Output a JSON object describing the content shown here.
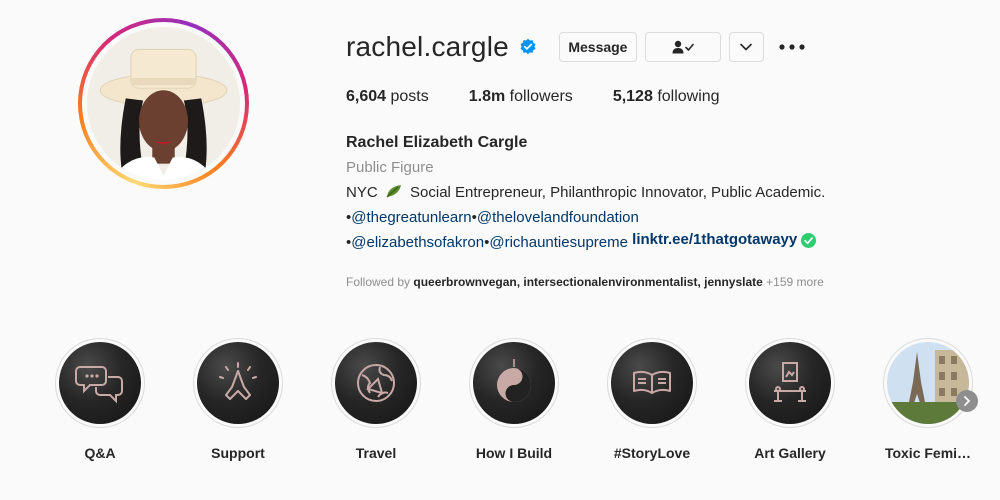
{
  "profile": {
    "username": "rachel.cargle",
    "message_label": "Message",
    "stats": {
      "posts_value": "6,604",
      "posts_label": "posts",
      "followers_value": "1.8m",
      "followers_label": "followers",
      "following_value": "5,128",
      "following_label": "following"
    },
    "bio": {
      "full_name": "Rachel Elizabeth Cargle",
      "category": "Public Figure",
      "line1_prefix": "NYC",
      "line1_text": "Social Entrepreneur, Philanthropic Innovator, Public Academic.",
      "bullet": "•",
      "mention1": "@thegreatunlearn",
      "mention2": "@thelovelandfoundation",
      "mention3": "@elizabethsofakron",
      "mention4": "@richauntiesupreme",
      "link": "linktr.ee/1thatgotawayy"
    },
    "followed_by": {
      "prefix": "Followed by",
      "names": "queerbrownvegan, intersectionalenvironmentalist, jennyslate",
      "more": "+159 more"
    }
  },
  "highlights": [
    {
      "label": "Q&A",
      "icon": "chat-bubbles-icon"
    },
    {
      "label": "Support",
      "icon": "praying-hands-icon"
    },
    {
      "label": "Travel",
      "icon": "globe-icon"
    },
    {
      "label": "How I Build",
      "icon": "yin-yang-icon"
    },
    {
      "label": "#StoryLove",
      "icon": "open-book-icon"
    },
    {
      "label": "Art Gallery",
      "icon": "gallery-frame-icon"
    },
    {
      "label": "Toxic Femi…",
      "icon": "paris-photo"
    }
  ],
  "colors": {
    "accent_blue": "#0095f6",
    "link_blue": "#00376b",
    "muted": "#8e8e8e",
    "icon_pink": "#c9a9a6"
  }
}
